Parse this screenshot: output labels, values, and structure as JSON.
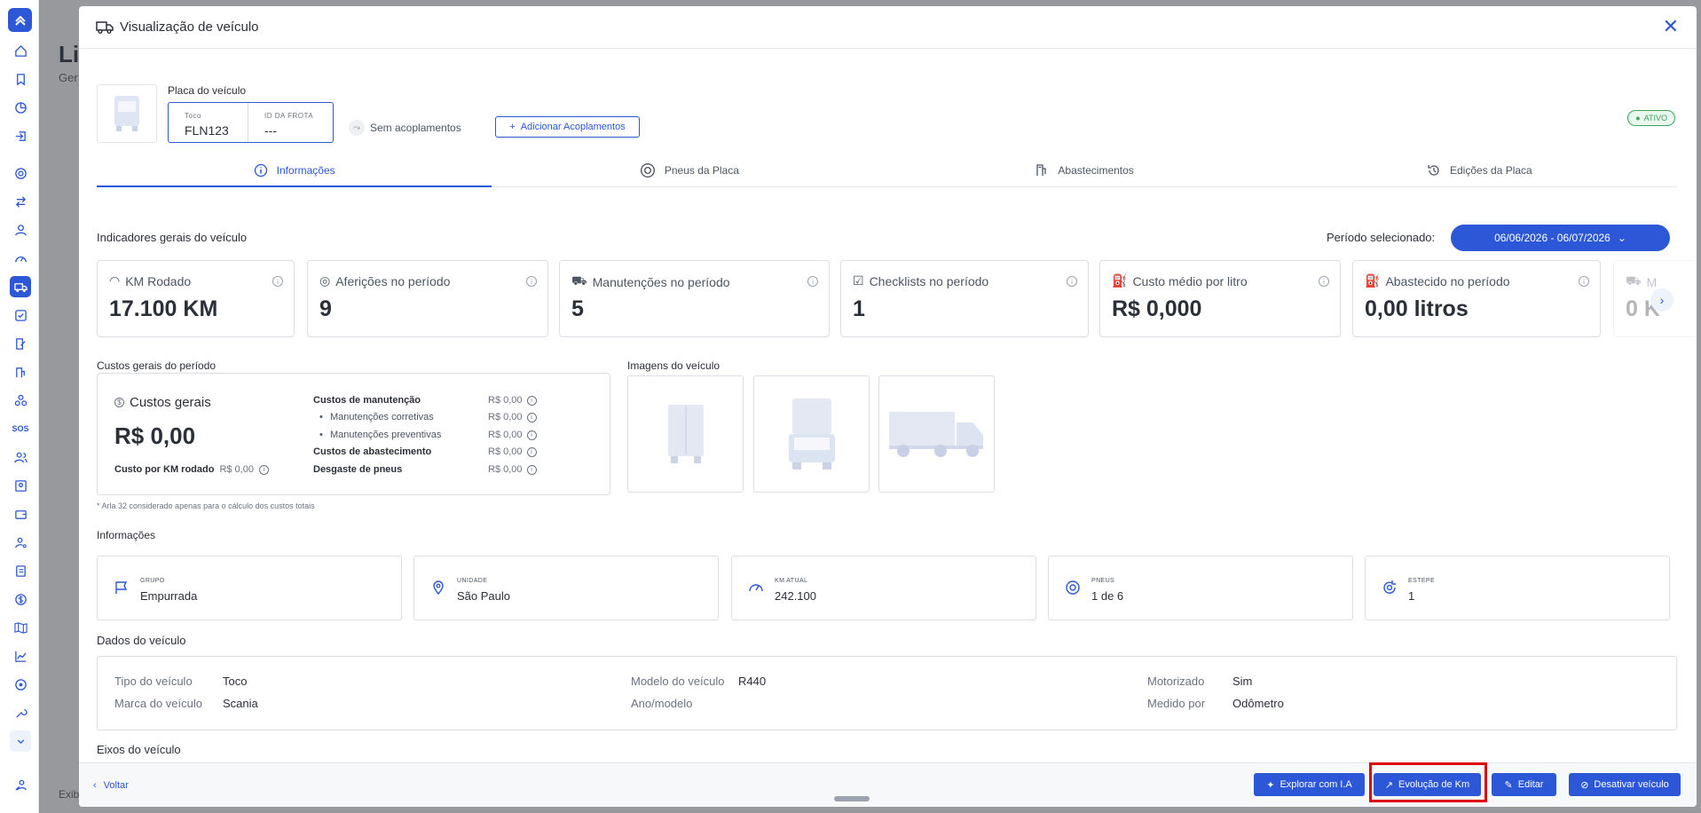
{
  "background": {
    "title": "Lis",
    "subtitle": "Ger",
    "footer": "Exib"
  },
  "sidebar": {
    "items": [
      "home-icon",
      "bookmark-icon",
      "pie-chart-icon",
      "login-icon",
      "tire-icon",
      "swap-icon",
      "user-icon",
      "gauge-icon",
      "truck-icon",
      "checklist-icon",
      "edit-doc-icon",
      "fuel-icon",
      "network-icon",
      "sos-icon",
      "users-icon",
      "badge-icon",
      "wallet-icon",
      "user-settings-icon",
      "contacts-icon",
      "dollar-icon",
      "map-icon",
      "line-chart-icon",
      "target-icon",
      "tool-icon",
      "expand-icon",
      "user-group-icon"
    ],
    "sos_label": "SOS"
  },
  "modal": {
    "title": "Visualização de veículo",
    "plate": {
      "label": "Placa do veículo",
      "type_label": "Toco",
      "plate_value": "FLN123",
      "fleet_label": "ID DA FROTA",
      "fleet_value": "---"
    },
    "no_coupling": "Sem acoplamentos",
    "add_coupling": "Adicionar Acoplamentos",
    "status": "ATIVO",
    "tabs": [
      {
        "label": "Informações"
      },
      {
        "label": "Pneus da Placa"
      },
      {
        "label": "Abastecimentos"
      },
      {
        "label": "Edições da Placa"
      }
    ],
    "indicators": {
      "title": "Indicadores gerais do veículo",
      "period_label": "Período selecionado:",
      "period_value": "06/06/2026 - 06/07/2026",
      "cards": [
        {
          "label": "KM Rodado",
          "value": "17.100 KM"
        },
        {
          "label": "Aferições no período",
          "value": "9"
        },
        {
          "label": "Manutenções no período",
          "value": "5"
        },
        {
          "label": "Checklists no período",
          "value": "1"
        },
        {
          "label": "Custo médio por litro",
          "value": "R$ 0,000"
        },
        {
          "label": "Abastecido no período",
          "value": "0,00 litros"
        },
        {
          "label": "M",
          "value": "0 K"
        }
      ]
    },
    "costs": {
      "title": "Custos gerais do período",
      "general_label": "Custos gerais",
      "general_value": "R$ 0,00",
      "per_km_label": "Custo por KM rodado",
      "per_km_value": "R$ 0,00",
      "rows": [
        {
          "name": "Custos de manutenção",
          "amount": "R$ 0,00"
        },
        {
          "name": "Manutenções corretivas",
          "amount": "R$ 0,00"
        },
        {
          "name": "Manutenções preventivas",
          "amount": "R$ 0,00"
        },
        {
          "name": "Custos de abastecimento",
          "amount": "R$ 0,00"
        },
        {
          "name": "Desgaste de pneus",
          "amount": "R$ 0,00"
        }
      ],
      "footnote": "* Arla 32 considerado apenas para o cálculo dos custos totais"
    },
    "images": {
      "title": "Imagens do veículo"
    },
    "info": {
      "title": "Informações",
      "cards": [
        {
          "key": "GRUPO",
          "value": "Empurrada"
        },
        {
          "key": "UNIDADE",
          "value": "São Paulo"
        },
        {
          "key": "KM ATUAL",
          "value": "242.100"
        },
        {
          "key": "PNEUS",
          "value": "1 de 6"
        },
        {
          "key": "ESTEPE",
          "value": "1"
        }
      ]
    },
    "vehicle_data": {
      "title": "Dados do veículo",
      "tipo_label": "Tipo do veículo",
      "tipo_value": "Toco",
      "marca_label": "Marca do veículo",
      "marca_value": "Scania",
      "modelo_label": "Modelo do veículo",
      "modelo_value": "R440",
      "ano_label": "Ano/modelo",
      "ano_value": "",
      "motorizado_label": "Motorizado",
      "motorizado_value": "Sim",
      "medido_label": "Medido por",
      "medido_value": "Odômetro"
    },
    "axles_title": "Eixos do veículo",
    "footer": {
      "back": "Voltar",
      "explore": "Explorar com I.A",
      "km_evolution": "Evolução de Km",
      "edit": "Editar",
      "deactivate": "Desativar veículo"
    }
  },
  "colors": {
    "primary": "#2c57d6",
    "active_status": "#3aa55c",
    "highlight": "#e00000"
  }
}
